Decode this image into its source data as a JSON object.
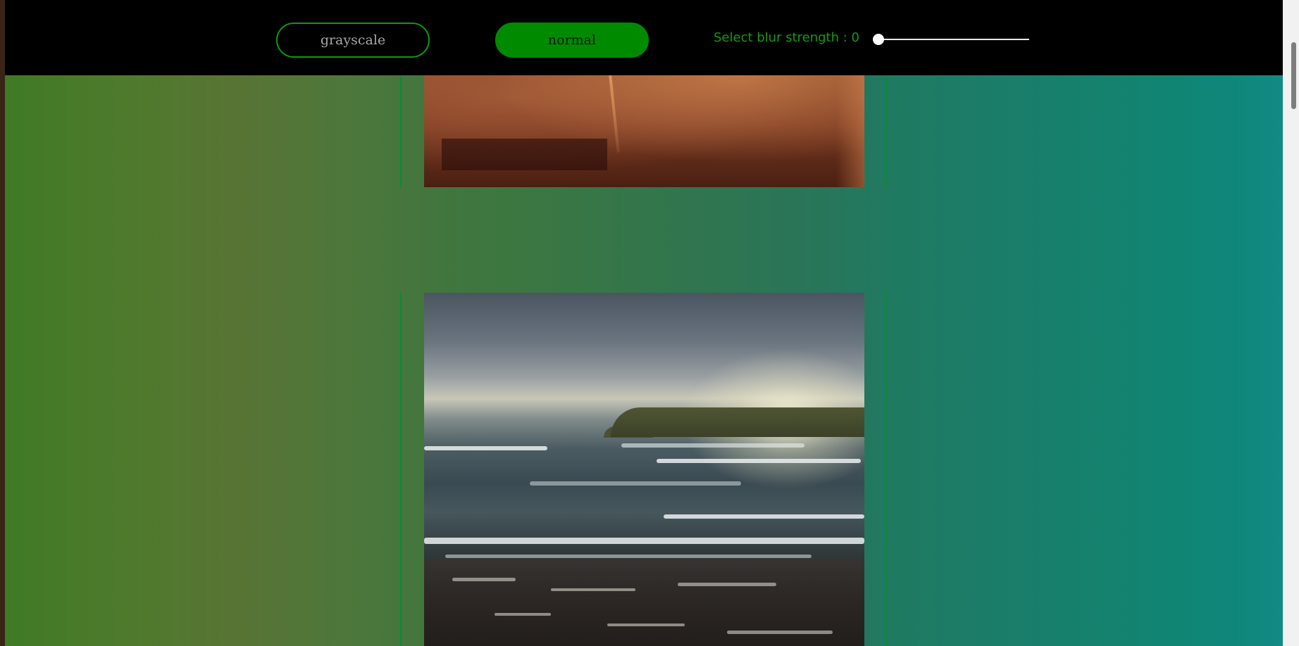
{
  "toolbar": {
    "grayscale_label": "grayscale",
    "normal_label": "normal",
    "blur_label": "Select blur strength : 0",
    "blur_value": 0
  },
  "gallery": {
    "images": [
      {
        "name": "warm-toned-photo-partial"
      },
      {
        "name": "ocean-waves-at-sunset-photo"
      }
    ]
  },
  "colors": {
    "accent": "#008a00",
    "label_green": "#149a14",
    "topbar": "#000000"
  }
}
